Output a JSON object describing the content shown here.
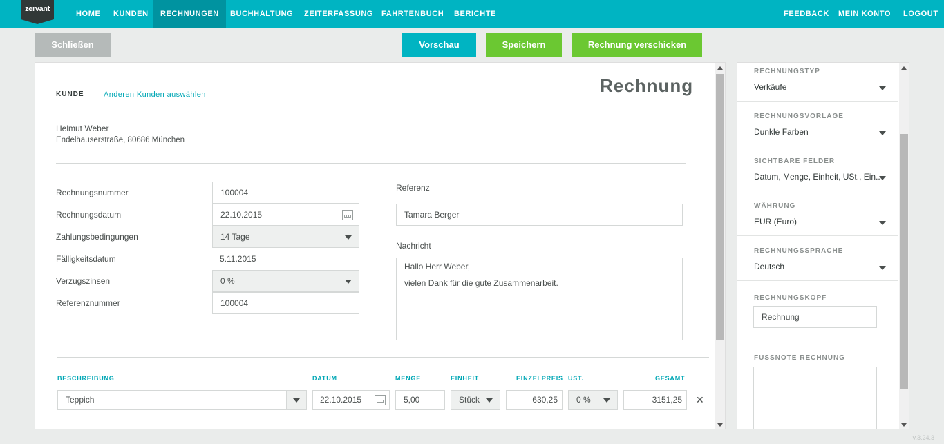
{
  "brand": "zervant",
  "nav": {
    "left": [
      "HOME",
      "KUNDEN",
      "RECHNUNGEN",
      "BUCHHALTUNG",
      "ZEITERFASSUNG",
      "FAHRTENBUCH",
      "BERICHTE"
    ],
    "right": [
      "FEEDBACK",
      "MEIN KONTO",
      "LOGOUT"
    ],
    "active": "RECHNUNGEN"
  },
  "actions": {
    "close": "Schließen",
    "preview": "Vorschau",
    "save": "Speichern",
    "send": "Rechnung verschicken"
  },
  "invoice": {
    "title": "Rechnung",
    "customer_label": "KUNDE",
    "change_customer": "Anderen Kunden auswählen",
    "customer_name": "Helmut Weber",
    "customer_address": "Endelhauserstraße, 80686 München",
    "fields": {
      "number_label": "Rechnungsnummer",
      "number_value": "100004",
      "date_label": "Rechnungsdatum",
      "date_value": "22.10.2015",
      "terms_label": "Zahlungsbedingungen",
      "terms_value": "14 Tage",
      "due_label": "Fälligkeitsdatum",
      "due_value": "5.11.2015",
      "interest_label": "Verzugszinsen",
      "interest_value": "0 %",
      "ref_number_label": "Referenznummer",
      "ref_number_value": "100004"
    },
    "reference_label": "Referenz",
    "reference_value": "Tamara Berger",
    "message_label": "Nachricht",
    "message_line1": "Hallo Herr Weber,",
    "message_line2": "vielen Dank für die gute Zusammenarbeit."
  },
  "items": {
    "headers": {
      "description": "BESCHREIBUNG",
      "date": "DATUM",
      "quantity": "MENGE",
      "unit": "EINHEIT",
      "unit_price": "EINZELPREIS",
      "vat": "UST.",
      "total": "GESAMT"
    },
    "row": {
      "description": "Teppich",
      "date": "22.10.2015",
      "quantity": "5,00",
      "unit": "Stück",
      "unit_price": "630,25",
      "vat": "0 %",
      "total": "3151,25",
      "remove": "✕"
    }
  },
  "sidebar": {
    "type_label": "RECHNUNGSTYP",
    "type_value": "Verkäufe",
    "template_label": "RECHNUNGSVORLAGE",
    "template_value": "Dunkle Farben",
    "fields_label": "SICHTBARE FELDER",
    "fields_value": "Datum, Menge, Einheit, USt., Ein...",
    "currency_label": "WÄHRUNG",
    "currency_value": "EUR (Euro)",
    "language_label": "RECHNUNGSSPRACHE",
    "language_value": "Deutsch",
    "header_label": "RECHNUNGSKOPF",
    "header_value": "Rechnung",
    "footnote_label": "FUSSNOTE RECHNUNG"
  },
  "version": "v.3.24.3",
  "colors": {
    "nav": "#00b4c2",
    "nav_active": "#0093a0",
    "primary": "#00b4c2",
    "success": "#6bc832",
    "neutral_button": "#b5bab9"
  }
}
